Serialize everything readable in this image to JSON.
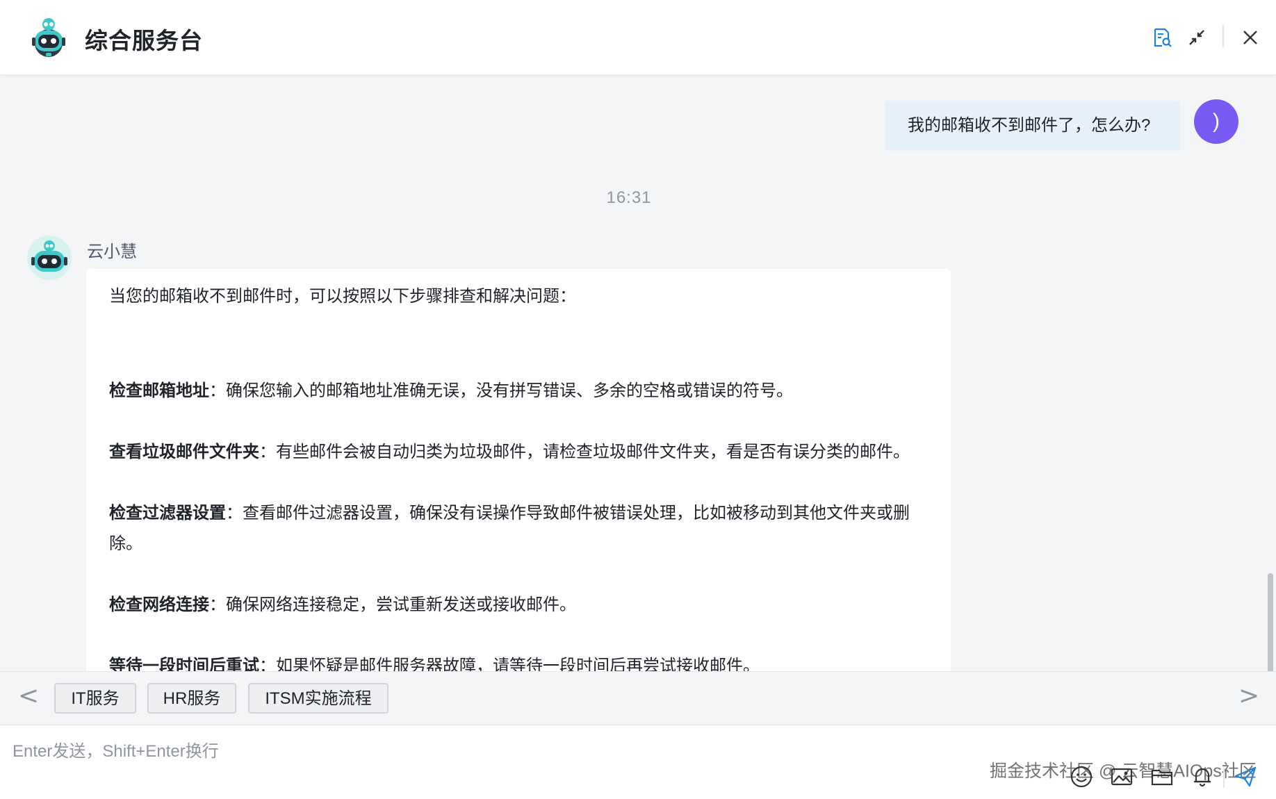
{
  "header": {
    "title": "综合服务台",
    "icons": [
      "document-search-icon",
      "minimize-icon",
      "close-icon"
    ]
  },
  "chat": {
    "user_message": "我的邮箱收不到邮件了，怎么办?",
    "user_avatar_text": ")",
    "timestamp": "16:31",
    "bot_name": "云小慧",
    "bot_reply": {
      "intro": "当您的邮箱收不到邮件时，可以按照以下步骤排查和解决问题：",
      "items": [
        {
          "title": "检查邮箱地址",
          "text": "：确保您输入的邮箱地址准确无误，没有拼写错误、多余的空格或错误的符号。"
        },
        {
          "title": "查看垃圾邮件文件夹",
          "text": "：有些邮件会被自动归类为垃圾邮件，请检查垃圾邮件文件夹，看是否有误分类的邮件。"
        },
        {
          "title": "检查过滤器设置",
          "text": "：查看邮件过滤器设置，确保没有误操作导致邮件被错误处理，比如被移动到其他文件夹或删除。"
        },
        {
          "title": "检查网络连接",
          "text": "：确保网络连接稳定，尝试重新发送或接收邮件。"
        },
        {
          "title": "等待一段时间后重试",
          "text": "：如果怀疑是邮件服务器故障，请等待一段时间后再尝试接收邮件。"
        }
      ]
    }
  },
  "tags": {
    "prev": "<",
    "next": ">",
    "items": [
      "IT服务",
      "HR服务",
      "ITSM实施流程"
    ]
  },
  "input": {
    "placeholder": "Enter发送，Shift+Enter换行",
    "tools": [
      "emoji-icon",
      "image-icon",
      "folder-icon",
      "bell-icon",
      "send-icon"
    ]
  },
  "watermark": "掘金技术社区 @ 云智慧AIOps社区",
  "colors": {
    "accent": "#1e80e0",
    "user_avatar": "#7a5af5",
    "user_bubble": "#e6f1fb",
    "bot_teal": "#3fc8c8"
  }
}
